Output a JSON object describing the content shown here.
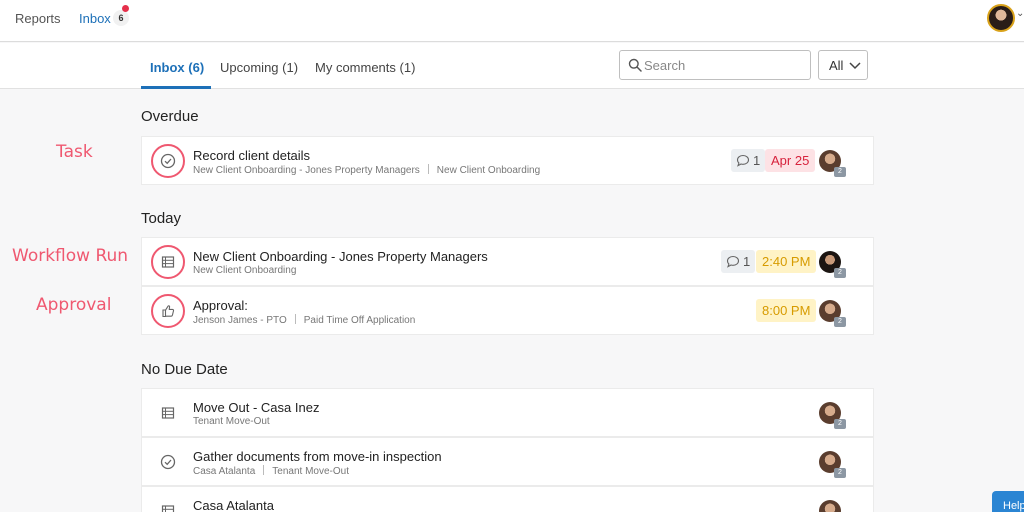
{
  "topnav": {
    "reports_label": "Reports",
    "inbox_label": "Inbox",
    "inbox_count": "6"
  },
  "tabs": [
    {
      "label": "Inbox (6)",
      "active": true
    },
    {
      "label": "Upcoming (1)",
      "active": false
    },
    {
      "label": "My comments (1)",
      "active": false
    }
  ],
  "search": {
    "placeholder": "Search",
    "value": ""
  },
  "filter": {
    "selected": "All"
  },
  "sections": {
    "overdue": {
      "title": "Overdue",
      "rows": [
        {
          "title": "Record client details",
          "subtitle": [
            "New Client Onboarding - Jones Property Managers",
            "New Client Onboarding"
          ],
          "icon": "check-circle-icon",
          "comments": "1",
          "due": "Apr 25",
          "assignee_count": "2"
        }
      ]
    },
    "today": {
      "title": "Today",
      "rows": [
        {
          "title": "New Client Onboarding - Jones Property Managers",
          "subtitle": [
            "New Client Onboarding"
          ],
          "icon": "list-icon",
          "comments": "1",
          "due": "2:40 PM",
          "assignee_count": "2"
        },
        {
          "title": "Approval:",
          "subtitle": [
            "Jenson James - PTO",
            "Paid Time Off Application"
          ],
          "icon": "thumbs-up-icon",
          "due": "8:00 PM",
          "assignee_count": "2"
        }
      ]
    },
    "no_due": {
      "title": "No Due Date",
      "rows": [
        {
          "title": "Move Out - Casa Inez",
          "subtitle": [
            "Tenant Move-Out"
          ],
          "icon": "list-icon",
          "assignee_count": "2"
        },
        {
          "title": "Gather documents from move-in inspection",
          "subtitle": [
            "Casa Atalanta",
            "Tenant Move-Out"
          ],
          "icon": "check-circle-icon",
          "assignee_count": "2"
        },
        {
          "title": "Casa Atalanta",
          "subtitle": [],
          "icon": "list-icon",
          "assignee_count": "2"
        }
      ]
    }
  },
  "annotations": {
    "task": "Task",
    "workflow_run": "Workflow Run",
    "approval": "Approval"
  },
  "help_label": "Help",
  "colors": {
    "accent": "#1d70b8",
    "overdue": "#d7223c",
    "today": "#d79b00",
    "annotation": "#ef5870"
  }
}
